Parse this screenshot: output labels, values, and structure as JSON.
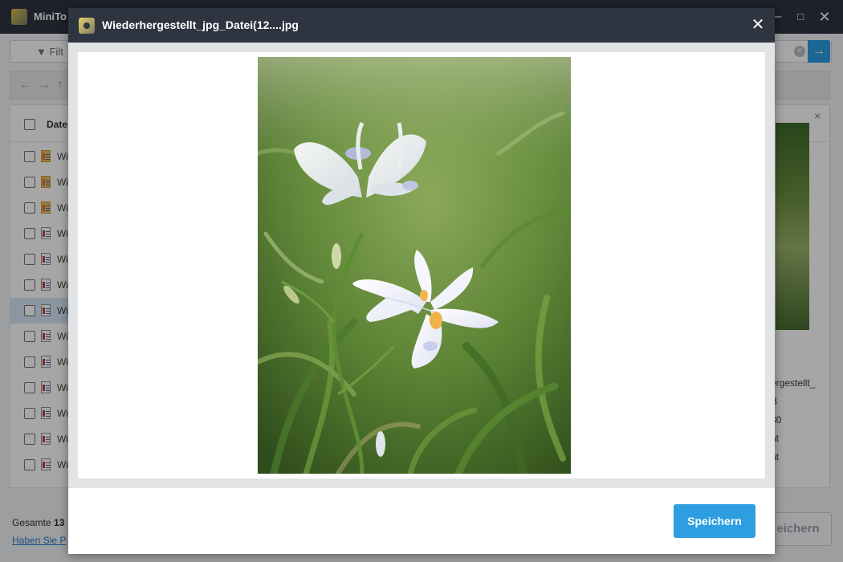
{
  "app": {
    "title": "MiniTo",
    "window_controls": {
      "minimize": "–",
      "maximize": "□",
      "close": "✕"
    },
    "filter": {
      "label": "Filt",
      "clear_icon": "×",
      "go_icon": "→"
    },
    "nav": {
      "back": "←",
      "forward": "→",
      "up": "↑"
    },
    "list": {
      "header_label": "Date",
      "rows": [
        {
          "name": "Wi",
          "icon": "archive-file-icon"
        },
        {
          "name": "Wi",
          "icon": "archive-file-icon"
        },
        {
          "name": "Wi",
          "icon": "archive-file-icon"
        },
        {
          "name": "Wi",
          "icon": "document-file-icon"
        },
        {
          "name": "Wi",
          "icon": "document-file-icon"
        },
        {
          "name": "Wi",
          "icon": "document-file-icon"
        },
        {
          "name": "Wi",
          "icon": "document-file-icon",
          "selected": true
        },
        {
          "name": "Wi",
          "icon": "document-file-icon"
        },
        {
          "name": "Wi",
          "icon": "document-file-icon"
        },
        {
          "name": "Wi",
          "icon": "document-file-icon"
        },
        {
          "name": "Wi",
          "icon": "document-file-icon"
        },
        {
          "name": "Wi",
          "icon": "document-file-icon"
        },
        {
          "name": "Wi",
          "icon": "document-file-icon"
        }
      ]
    },
    "preview_panel": {
      "close_icon": "×",
      "lines": [
        "ergestellt_",
        "B",
        "30",
        "nt",
        "nt"
      ]
    },
    "bottom": {
      "total_prefix": "Gesamte ",
      "total_value": "13",
      "help_link": "Haben Sie P",
      "save_label": "eichern"
    }
  },
  "dialog": {
    "title": "Wiederhergestellt_jpg_Datei(12....jpg",
    "close_icon": "✕",
    "save_label": "Speichern"
  },
  "colors": {
    "titlebar": "#2e3440",
    "accent": "#2d9fe0",
    "selection": "#d6e6f6"
  }
}
